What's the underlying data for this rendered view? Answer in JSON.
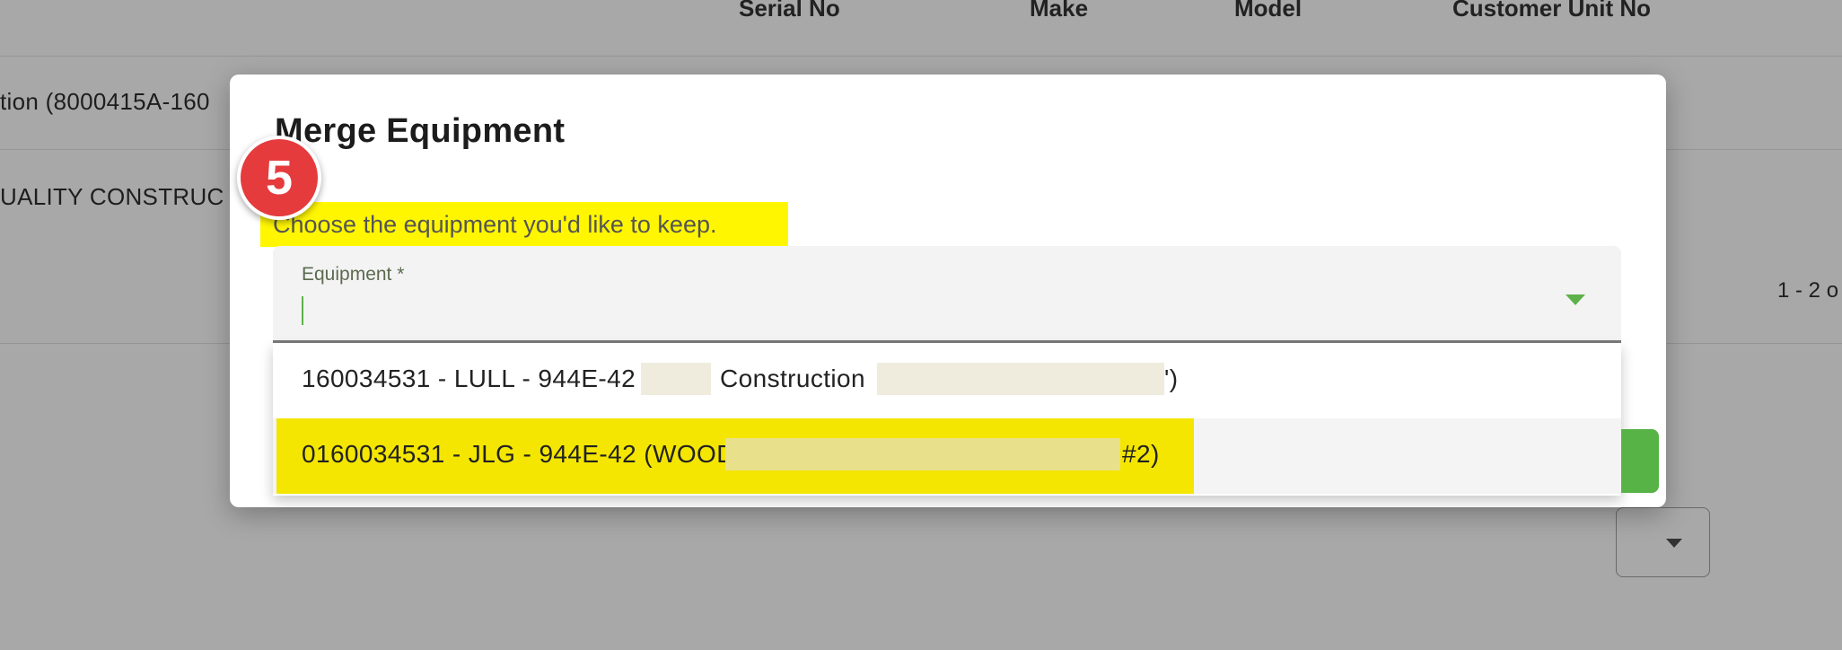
{
  "background": {
    "columns": [
      "Serial No",
      "Make",
      "Model",
      "Customer Unit No"
    ],
    "rows": [
      "tion (8000415A-160",
      "UALITY CONSTRUC"
    ],
    "pager": "1 - 2 o"
  },
  "dialog": {
    "title": "Merge Equipment",
    "step_number": "5",
    "instruction": "Choose the equipment you'd like to keep.",
    "field": {
      "label": "Equipment *",
      "value": ""
    },
    "options": [
      {
        "text_prefix": "160034531 - LULL - 944E-42 (",
        "text_middle": "Construction",
        "text_suffix": "')"
      },
      {
        "text_prefix": "0160034531 - JLG - 944E-42 (WOOD",
        "text_suffix": "#2)"
      }
    ]
  },
  "colors": {
    "accent_green": "#57b346",
    "highlight_yellow": "#fff600",
    "step_badge_red": "#e53b3d",
    "overlay_gray": "#a8a8a8"
  },
  "icons": {
    "field_dropdown": "chevron-down-icon",
    "background_select": "chevron-down-icon"
  }
}
